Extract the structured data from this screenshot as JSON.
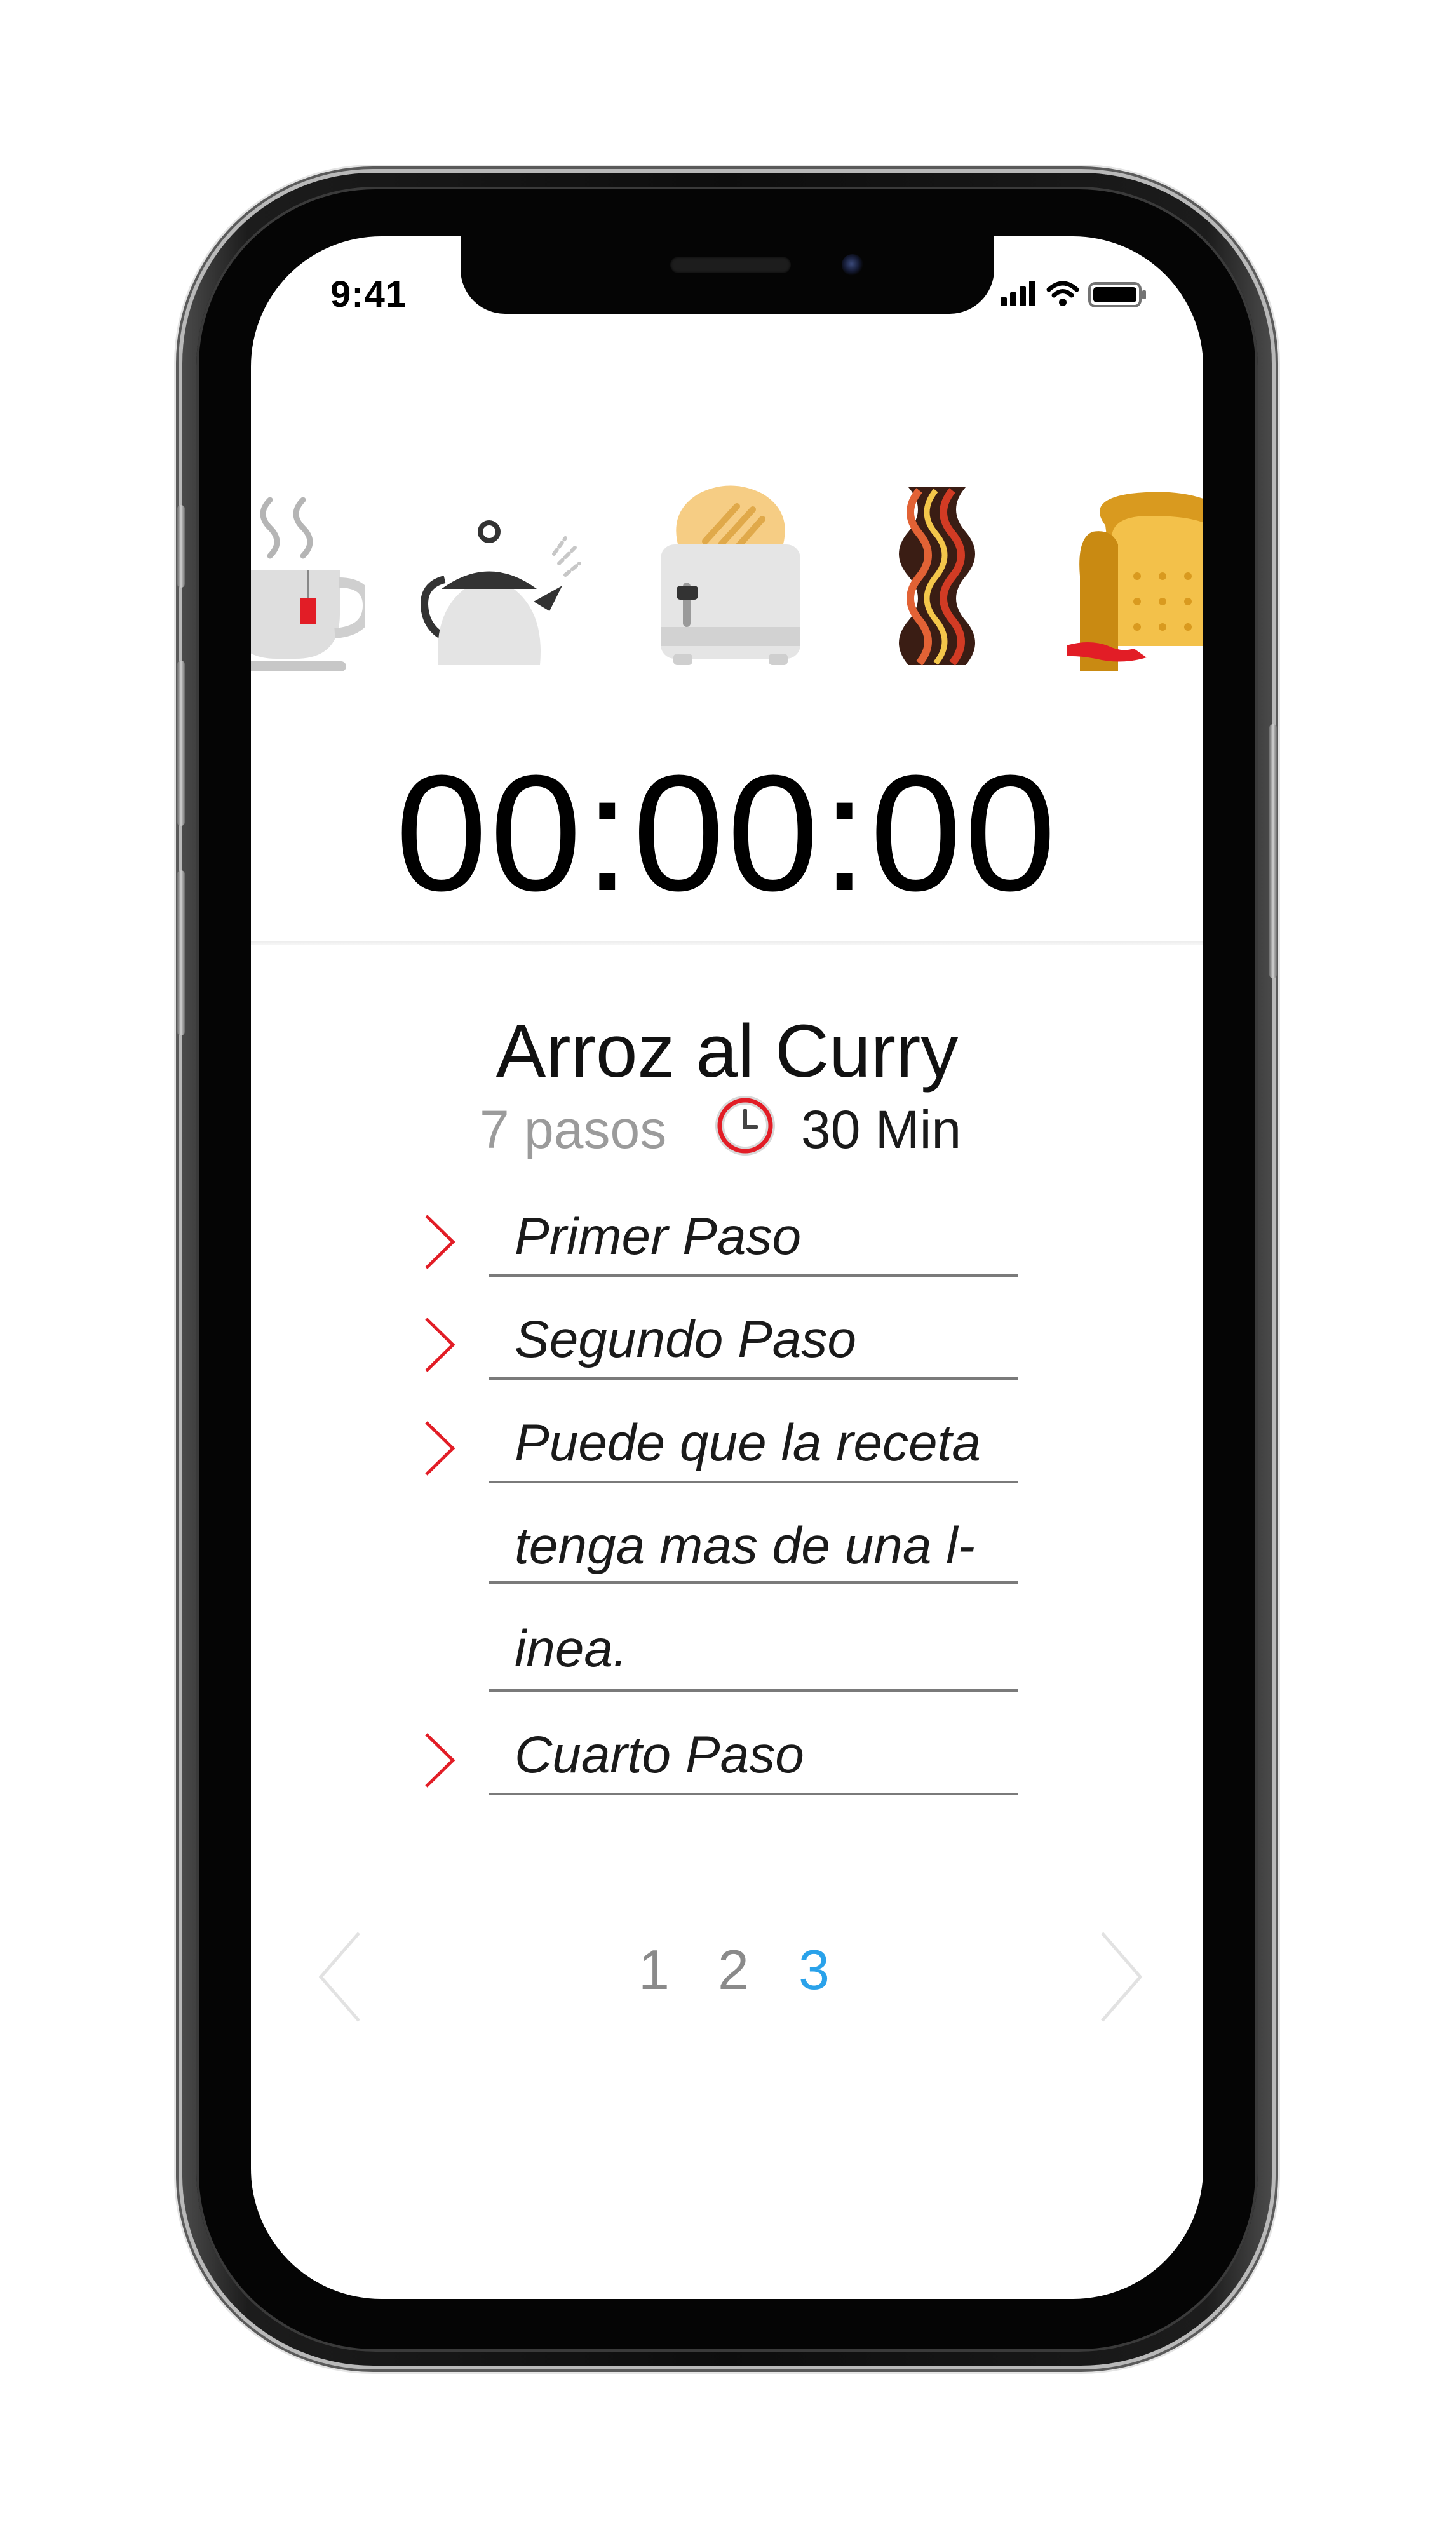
{
  "status_bar": {
    "time": "9:41"
  },
  "food_icons": [
    "tea-cup-icon",
    "kettle-icon",
    "toaster-icon",
    "bacon-icon",
    "bread-icon"
  ],
  "timer": {
    "display": "00:00:00"
  },
  "recipe": {
    "title": "Arroz al Curry",
    "steps_count": "7 pasos",
    "duration": "30 Min"
  },
  "steps": [
    {
      "lines": [
        "Primer Paso"
      ]
    },
    {
      "lines": [
        "Segundo Paso"
      ]
    },
    {
      "lines": [
        "Puede que la receta",
        "tenga mas de una l-",
        "inea."
      ]
    },
    {
      "lines": [
        "Cuarto Paso"
      ]
    }
  ],
  "pagination": {
    "pages": [
      "1",
      "2",
      "3"
    ],
    "current": "3"
  },
  "colors": {
    "accent_red": "#e21d26",
    "active_page": "#2aa2ea",
    "muted_text": "#9b9b9b"
  }
}
